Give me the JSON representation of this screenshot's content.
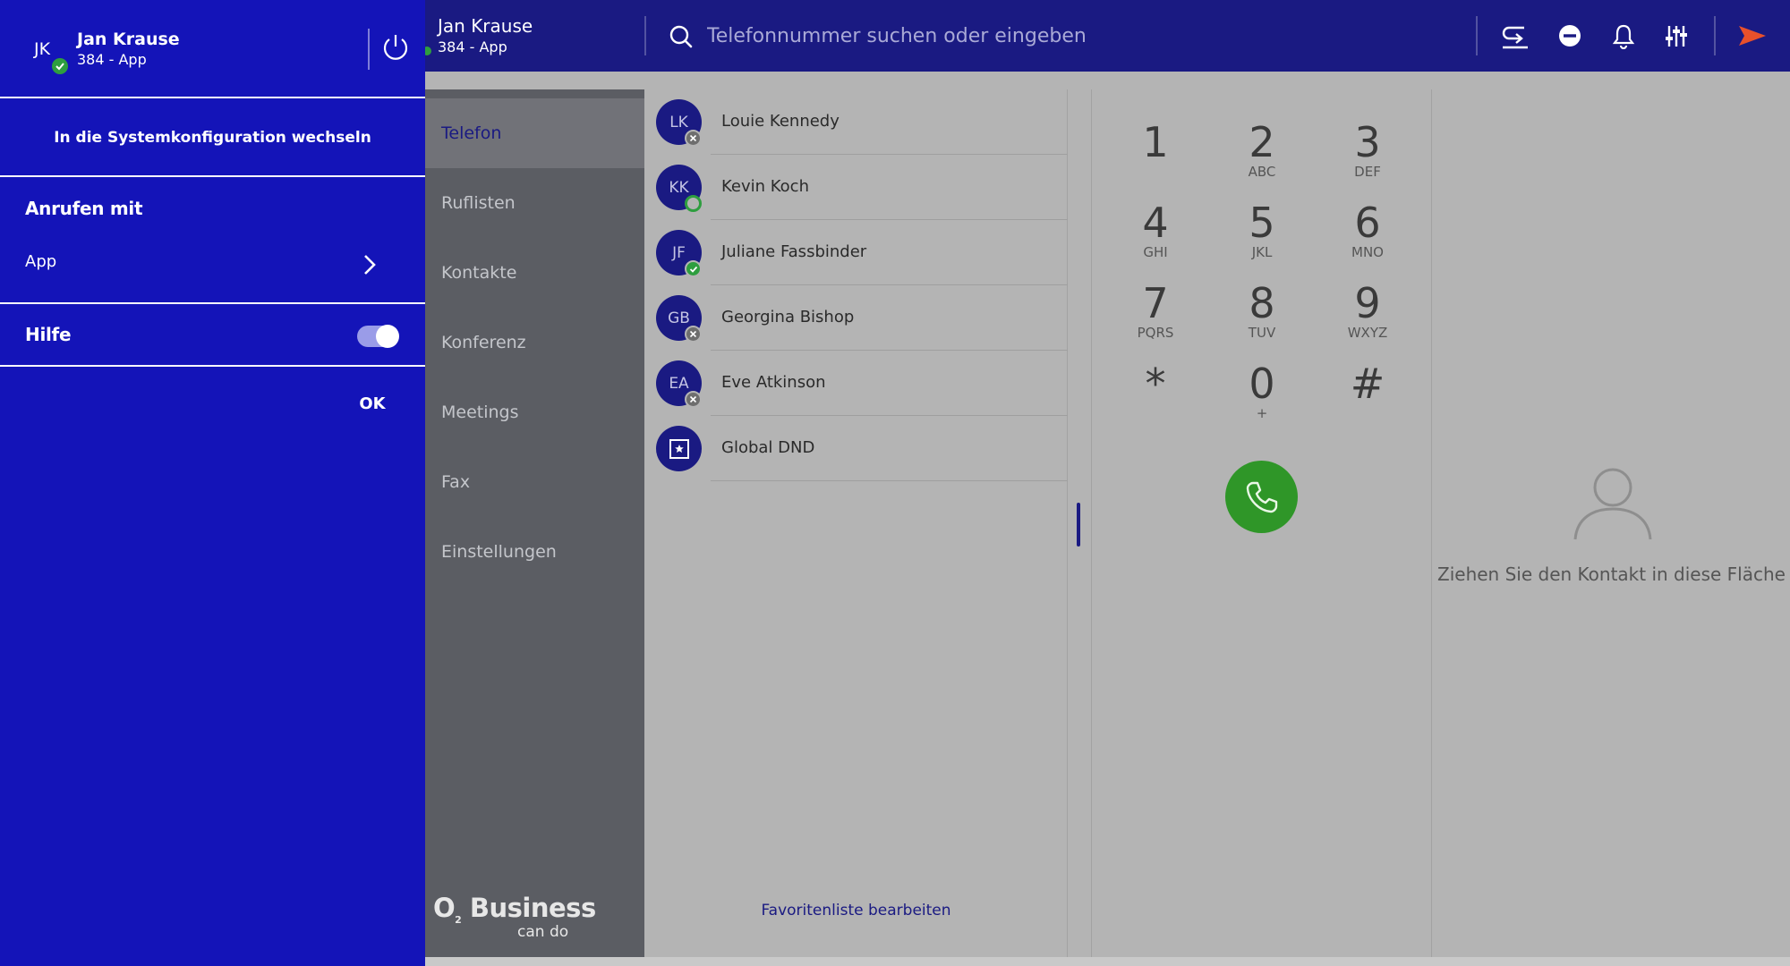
{
  "header": {
    "user_name": "Jan Krause",
    "user_line": "384 - App",
    "search_placeholder": "Telefonnummer suchen oder eingeben",
    "icons": [
      "call-transfer-icon",
      "do-not-disturb-icon",
      "bell-icon",
      "sliders-icon",
      "send-icon"
    ]
  },
  "drawer": {
    "initials": "JK",
    "name": "Jan Krause",
    "line": "384 - App",
    "system_config_label": "In die Systemkonfiguration wechseln",
    "call_with_heading": "Anrufen mit",
    "call_with_value": "App",
    "help_label": "Hilfe",
    "help_enabled": true,
    "ok_label": "OK"
  },
  "nav": {
    "items": [
      {
        "label": "Telefon",
        "active": true
      },
      {
        "label": "Ruflisten",
        "active": false
      },
      {
        "label": "Kontakte",
        "active": false
      },
      {
        "label": "Konferenz",
        "active": false
      },
      {
        "label": "Meetings",
        "active": false
      },
      {
        "label": "Fax",
        "active": false
      },
      {
        "label": "Einstellungen",
        "active": false
      }
    ]
  },
  "brand": {
    "logo_o": "O",
    "logo_2": "2",
    "logo_word": "Business",
    "tagline": "can do"
  },
  "favorites": {
    "items": [
      {
        "initials": "LK",
        "name": "Louie Kennedy",
        "status": "offline"
      },
      {
        "initials": "KK",
        "name": "Kevin Koch",
        "status": "available-ring"
      },
      {
        "initials": "JF",
        "name": "Juliane Fassbinder",
        "status": "available"
      },
      {
        "initials": "GB",
        "name": "Georgina Bishop",
        "status": "offline"
      },
      {
        "initials": "EA",
        "name": "Eve Atkinson",
        "status": "offline"
      },
      {
        "initials": "",
        "name": "Global DND",
        "status": "none"
      }
    ],
    "edit_label": "Favoritenliste bearbeiten"
  },
  "dialpad": {
    "keys": [
      {
        "digit": "1",
        "letters": ""
      },
      {
        "digit": "2",
        "letters": "ABC"
      },
      {
        "digit": "3",
        "letters": "DEF"
      },
      {
        "digit": "4",
        "letters": "GHI"
      },
      {
        "digit": "5",
        "letters": "JKL"
      },
      {
        "digit": "6",
        "letters": "MNO"
      },
      {
        "digit": "7",
        "letters": "PQRS"
      },
      {
        "digit": "8",
        "letters": "TUV"
      },
      {
        "digit": "9",
        "letters": "WXYZ"
      },
      {
        "digit": "*",
        "letters": ""
      },
      {
        "digit": "0",
        "letters": "+"
      },
      {
        "digit": "#",
        "letters": ""
      }
    ]
  },
  "drop_area": {
    "text": "Ziehen Sie den Kontakt in diese Fläche"
  },
  "colors": {
    "header_bg": "#1a1a82",
    "drawer_bg": "#1414b8",
    "nav_bg": "#5b5d63",
    "content_bg": "#b4b4b4",
    "call_green": "#2f9628",
    "status_green": "#2e9e3f",
    "send_accent": "#e8502b"
  }
}
